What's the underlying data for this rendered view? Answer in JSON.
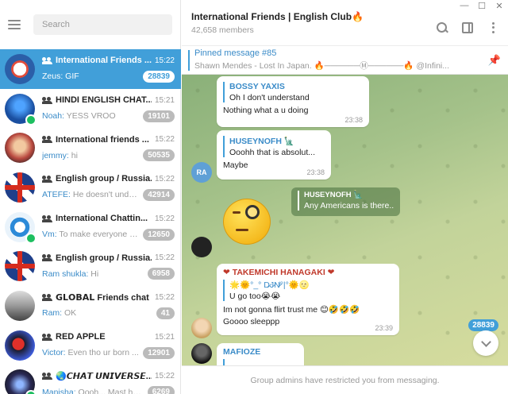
{
  "window": {
    "controls": [
      "minimize",
      "maximize",
      "close"
    ]
  },
  "sidebar": {
    "search_placeholder": "Search",
    "chats": [
      {
        "title": "International Friends ...",
        "time": "15:22",
        "sender": "Zeus:",
        "preview": " GIF",
        "unread": "28839",
        "active": true,
        "avatar_color": "#e9f0f7"
      },
      {
        "title": "HINDI ENGLISH CHAT...",
        "time": "15:21",
        "sender": "Noah:",
        "preview": " YESS VROO",
        "unread": "19101",
        "active": false,
        "avatar_color": "#1a4fa0"
      },
      {
        "title": "International friends ...",
        "time": "15:22",
        "sender": "jemmy:",
        "preview": " hi",
        "unread": "50535",
        "active": false,
        "avatar_color": "#b9493f"
      },
      {
        "title": "English group / Russia...",
        "time": "15:22",
        "sender": "ATEFE:",
        "preview": " He doesn't under...",
        "unread": "42914",
        "active": false,
        "avatar_color": "#1f3f8a"
      },
      {
        "title": "International Chattin...",
        "time": "15:22",
        "sender": "Vm:",
        "preview": " To make everyone n...",
        "unread": "12650",
        "active": false,
        "avatar_color": "#2c8ad8"
      },
      {
        "title": "English group / Russia...",
        "time": "15:22",
        "sender": "Ram shukla:",
        "preview": " Hi",
        "unread": "6958",
        "active": false,
        "avatar_color": "#1f3f8a"
      },
      {
        "title": "𝗚𝗟𝗢𝗕𝗔𝗟 Friends chat",
        "time": "15:22",
        "sender": "Ram:",
        "preview": " OK",
        "unread": "41",
        "active": false,
        "avatar_color": "#777777"
      },
      {
        "title": "RED APPLE",
        "time": "15:21",
        "sender": "Victor:",
        "preview": " Even tho ur born ...",
        "unread": "12901",
        "active": false,
        "avatar_color": "#1c1c2e"
      },
      {
        "title": "🌏𝘾𝙃𝘼𝙏 𝙐𝙉𝙄𝙑𝙀𝙍𝙎𝙀...",
        "time": "15:22",
        "sender": "Manisha:",
        "preview": " Oooh... Mast hai...",
        "unread": "6269",
        "active": false,
        "avatar_color": "#2a2a55"
      }
    ]
  },
  "header": {
    "title": "International Friends | English Club🔥",
    "subtitle": "42,658 members"
  },
  "pinned": {
    "title": "Pinned message #85",
    "text": "Shawn Mendes - Lost In Japan. 🔥──────Ⓜ──────🔥 @Infini..."
  },
  "messages": {
    "m1": {
      "reply_name": "BOSSY YAXIS",
      "reply_text": "Oh I don't understand",
      "text": "Nothing what a u doing",
      "time": "23:38"
    },
    "m2": {
      "avatar_initials": "RA",
      "reply_name": "HUSEYNOFH 🗽",
      "reply_text": "Ooohh that is absolut...",
      "text": "Maybe",
      "time": "23:38"
    },
    "m3": {
      "reply_name": "HUSEYNOFH 🗽",
      "reply_text": "Any Americans is there..."
    },
    "m4": {
      "sender": "❤ TAKEMICHI HANAGAKI ❤",
      "reply_name": "🌟🌞°_° D̷J̷N̷ͥ°|°🌞🌝",
      "reply_text": "U go too😭😭",
      "text1": "Im not gonna flirt trust me 😊🤣🤣🤣",
      "text2": "Goooo sleeppp",
      "time": "23:39"
    },
    "m5": {
      "sender": "MAFIOZE"
    }
  },
  "unread_counter": "28839",
  "footer_text": "Group admins have restricted you from messaging.",
  "colors": {
    "accent": "#419fd9",
    "badge": "#bbbbbb",
    "online": "#1dbf60"
  }
}
